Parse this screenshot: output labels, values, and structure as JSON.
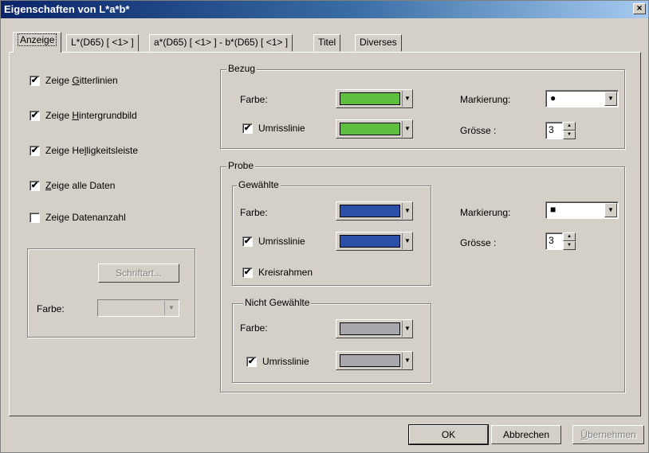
{
  "window": {
    "title": "Eigenschaften von L*a*b*",
    "close_label": "×"
  },
  "tabs": [
    {
      "label": "Anzeige",
      "active": true
    },
    {
      "label": "L*(D65) [ <1> ]",
      "active": false
    },
    {
      "label": "a*(D65) [ <1> ] - b*(D65) [ <1> ]",
      "active": false
    },
    {
      "label": "Titel",
      "active": false
    },
    {
      "label": "Diverses",
      "active": false
    }
  ],
  "options": [
    {
      "label_pre": "Zeige ",
      "label_u": "G",
      "label_post": "itterlinien",
      "checked": true
    },
    {
      "label_pre": "Zeige ",
      "label_u": "H",
      "label_post": "intergrundbild",
      "checked": true
    },
    {
      "label_pre": "Zeige He",
      "label_u": "l",
      "label_post": "ligkeitsleiste",
      "checked": true
    },
    {
      "label_pre": "",
      "label_u": "Z",
      "label_post": "eige alle Daten",
      "checked": true
    },
    {
      "label_pre": "Zeige Datenanzahl",
      "label_u": "",
      "label_post": "",
      "checked": false
    }
  ],
  "font": {
    "button_label": "Schriftart...",
    "color_label": "Farbe:"
  },
  "bezug": {
    "title": "Bezug",
    "farbe_label": "Farbe:",
    "farbe_color": "#5fc040",
    "umriss_label": "Umrisslinie",
    "umriss_checked": true,
    "umriss_color": "#5fc040",
    "markierung_label": "Markierung:",
    "markierung_symbol": "●",
    "groesse_label": "Grösse :",
    "groesse_value": "3"
  },
  "probe": {
    "title": "Probe",
    "gewaehlte": {
      "title": "Gewählte",
      "farbe_label": "Farbe:",
      "farbe_color": "#2c4fa8",
      "umriss_label": "Umrisslinie",
      "umriss_checked": true,
      "umriss_color": "#2c4fa8",
      "kreis_label": "Kreisrahmen",
      "kreis_checked": true
    },
    "nicht_gewaehlte": {
      "title": "Nicht Gewählte",
      "farbe_label": "Farbe:",
      "farbe_color": "#a8a8ac",
      "umriss_label": "Umrisslinie",
      "umriss_checked": true,
      "umriss_color": "#a8a8ac"
    },
    "markierung_label": "Markierung:",
    "markierung_symbol": "■",
    "groesse_label": "Grösse :",
    "groesse_value": "3"
  },
  "buttons": {
    "ok": "OK",
    "cancel": "Abbrechen",
    "apply_u": "Ü",
    "apply_rest": "bernehmen"
  },
  "glyphs": {
    "check": "✔",
    "down": "▼",
    "up": "▲"
  }
}
